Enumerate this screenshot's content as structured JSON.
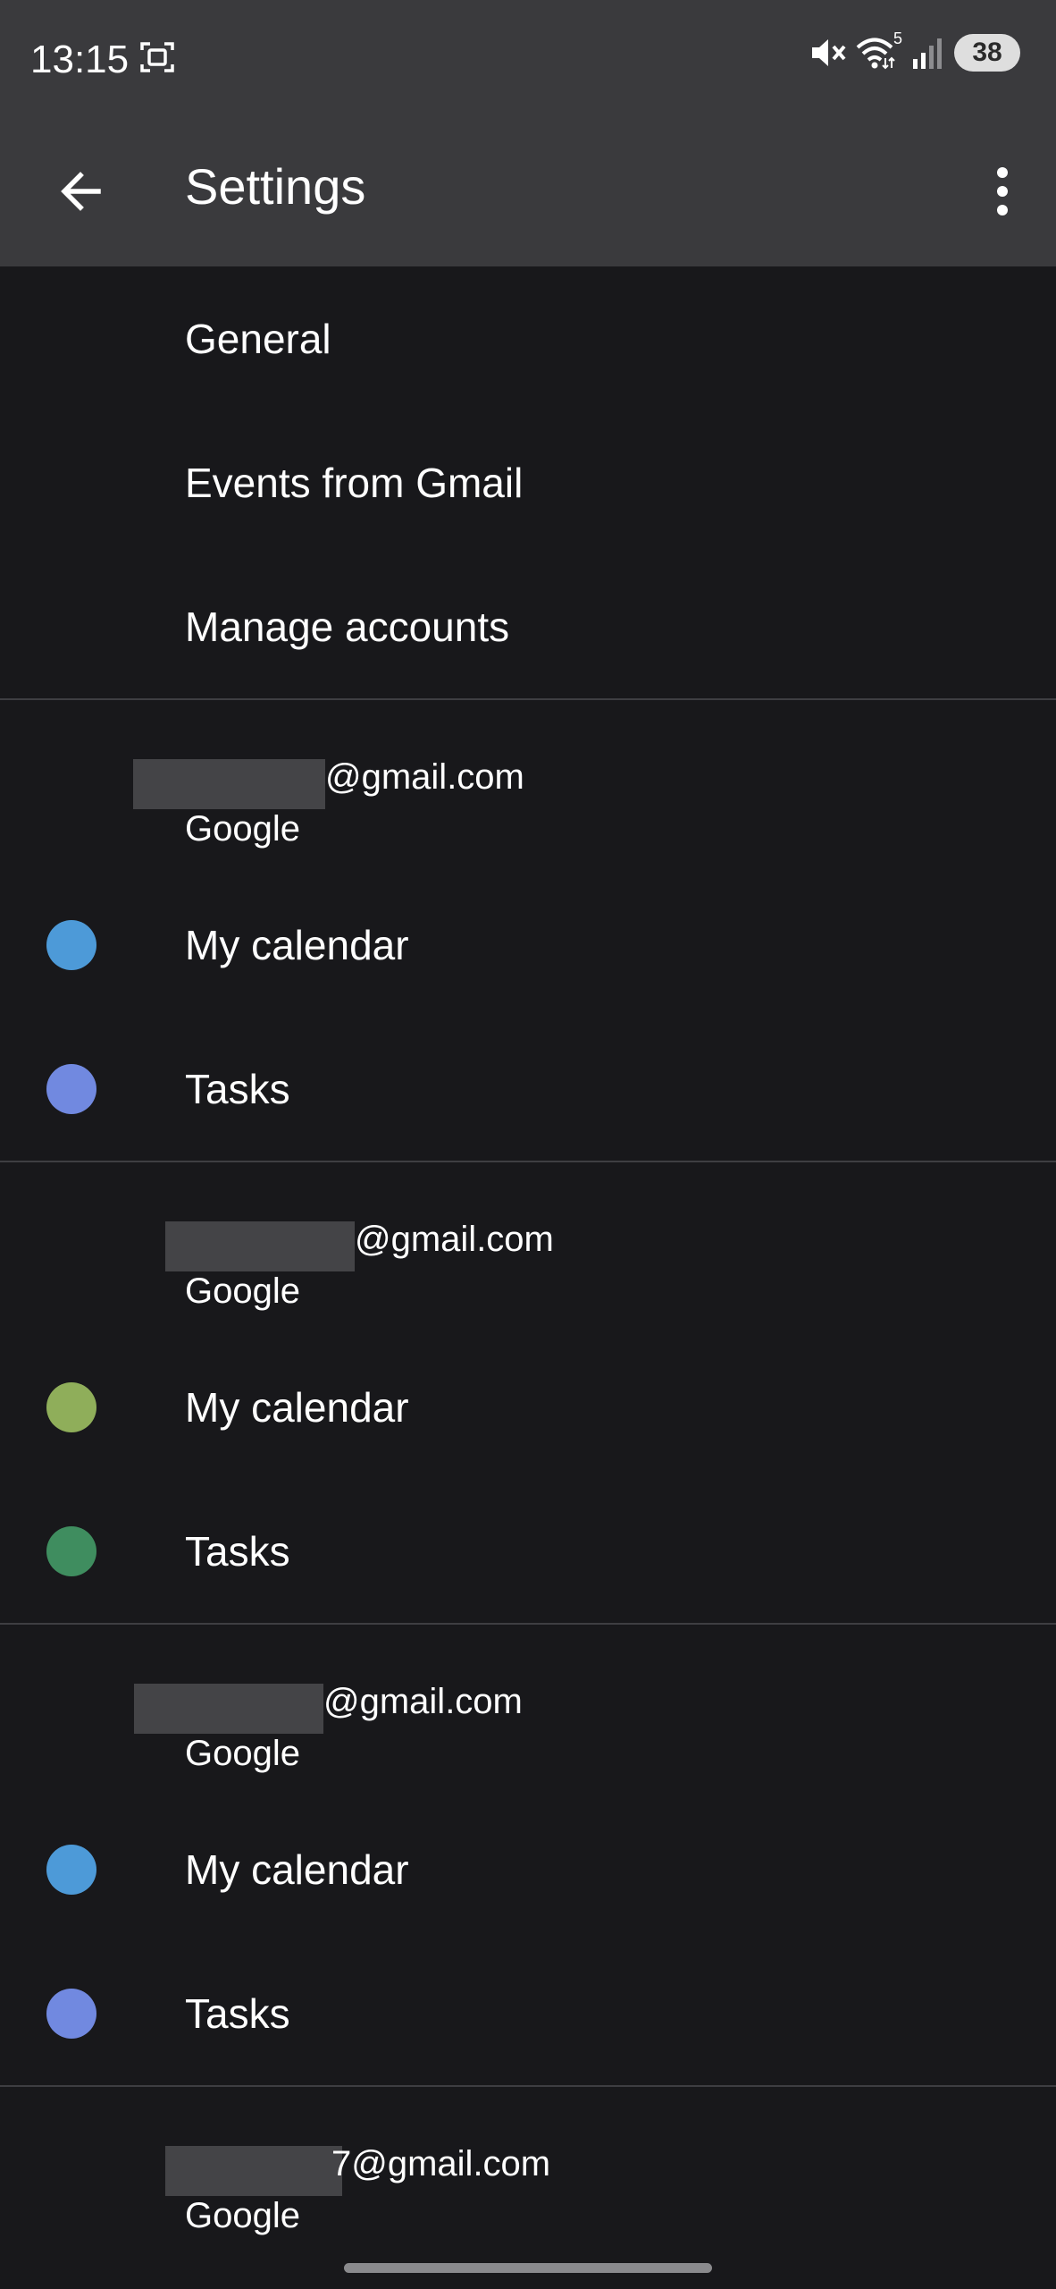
{
  "status_bar": {
    "time": "13:15",
    "wifi_badge": "5",
    "battery": "38",
    "icons": [
      "screenshot-icon",
      "mute-icon",
      "wifi-icon",
      "signal-icon"
    ]
  },
  "app_bar": {
    "title": "Settings",
    "icons": [
      "back-arrow-icon",
      "more-vert-icon"
    ]
  },
  "menu": {
    "items": [
      {
        "label": "General"
      },
      {
        "label": "Events from Gmail"
      },
      {
        "label": "Manage accounts"
      }
    ]
  },
  "accounts": [
    {
      "email_visible": "@gmail.com",
      "provider": "Google",
      "calendars": [
        {
          "label": "My calendar",
          "color": "#4d9ad8"
        },
        {
          "label": "Tasks",
          "color": "#7189e0"
        }
      ]
    },
    {
      "email_visible": "@gmail.com",
      "provider": "Google",
      "calendars": [
        {
          "label": "My calendar",
          "color": "#8fae5a"
        },
        {
          "label": "Tasks",
          "color": "#3f8d5f"
        }
      ]
    },
    {
      "email_visible": "@gmail.com",
      "provider": "Google",
      "calendars": [
        {
          "label": "My calendar",
          "color": "#4d9ad8"
        },
        {
          "label": "Tasks",
          "color": "#7189e0"
        }
      ]
    },
    {
      "email_visible": "7@gmail.com",
      "provider": "Google",
      "calendars": []
    }
  ],
  "colors": {
    "background": "#18181b",
    "app_bar": "#3a3a3d",
    "divider": "#3e3e42",
    "text": "#ffffff"
  }
}
